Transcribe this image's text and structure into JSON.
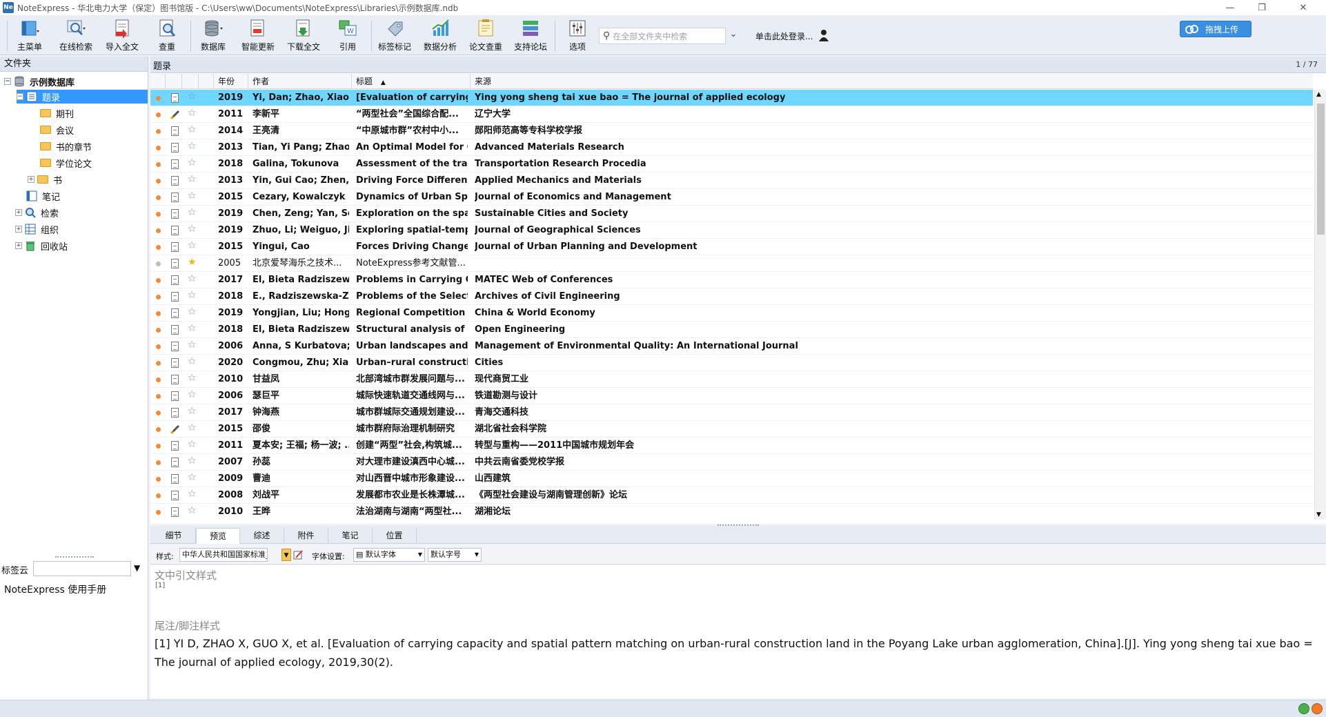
{
  "window": {
    "title": "NoteExpress - 华北电力大学（保定）图书馆版 - C:\\Users\\ww\\Documents\\NoteExpress\\Libraries\\示例数据库.ndb",
    "app_icon": "Ne"
  },
  "toolbar": {
    "buttons": [
      {
        "label": "主菜单",
        "icon": "main-menu-icon"
      },
      {
        "label": "在线检索",
        "icon": "online-search-icon"
      },
      {
        "label": "导入全文",
        "icon": "import-fulltext-icon"
      },
      {
        "label": "查重",
        "icon": "duplicate-check-icon"
      },
      {
        "label": "数据库",
        "icon": "database-icon"
      },
      {
        "label": "智能更新",
        "icon": "smart-update-icon"
      },
      {
        "label": "下载全文",
        "icon": "download-fulltext-icon"
      },
      {
        "label": "引用",
        "icon": "cite-icon"
      },
      {
        "label": "标签标记",
        "icon": "tag-icon"
      },
      {
        "label": "数据分析",
        "icon": "data-analysis-icon"
      },
      {
        "label": "论文查重",
        "icon": "paper-check-icon"
      },
      {
        "label": "支持论坛",
        "icon": "forum-icon"
      },
      {
        "label": "选项",
        "icon": "options-icon"
      }
    ],
    "search_placeholder": "在全部文件夹中检索",
    "login_label": "单击此处登录...",
    "upload_label": "拖拽上传"
  },
  "sidebar": {
    "header": "文件夹",
    "tree": [
      {
        "label": "示例数据库",
        "bold": true
      },
      {
        "label": "题录",
        "selected": true
      },
      {
        "label": "期刊"
      },
      {
        "label": "会议"
      },
      {
        "label": "书的章节"
      },
      {
        "label": "学位论文"
      },
      {
        "label": "书"
      },
      {
        "label": "笔记"
      },
      {
        "label": "检索"
      },
      {
        "label": "组织"
      },
      {
        "label": "回收站"
      }
    ],
    "tag_cloud_label": "标签云",
    "tag_items": [
      "NoteExpress  使用手册"
    ]
  },
  "list": {
    "header": "题录",
    "page_indicator": "1 / 77",
    "columns": [
      "年份",
      "作者",
      "标题",
      "来源"
    ],
    "sort_indicator": "▲",
    "rows": [
      {
        "year": "2019",
        "author": "Yi, Dan; Zhao, Xiao-...",
        "title": "[Evaluation of carrying c",
        "source": "Ying yong sheng tai xue bao = The journal of applied ecology",
        "selected": true
      },
      {
        "year": "2011",
        "author": "李新平",
        "title": "“两型社会”全国综合配...",
        "source": "辽宁大学",
        "pen": true
      },
      {
        "year": "2014",
        "author": "王亮清",
        "title": "“中原城市群”农村中小...",
        "source": "郧阳师范高等专科学校学报"
      },
      {
        "year": "2013",
        "author": "Tian, Yi Pang; Zhao,",
        "title": "An Optimal Model for C",
        "source": "Advanced Materials Research"
      },
      {
        "year": "2018",
        "author": "Galina, Tokunova",
        "title": "Assessment of the trans.",
        "source": "Transportation Research Procedia"
      },
      {
        "year": "2013",
        "author": "Yin, Gui Cao; Zhen, ..",
        "title": "Driving Force Difference",
        "source": "Applied Mechanics and Materials"
      },
      {
        "year": "2015",
        "author": "Cezary, Kowalczyk",
        "title": "Dynamics of Urban Spa.",
        "source": "Journal of Economics and Management"
      },
      {
        "year": "2019",
        "author": "Chen, Zeng; Yan, So.",
        "title": "Exploration on the spati",
        "source": "Sustainable Cities and Society"
      },
      {
        "year": "2019",
        "author": "Zhuo, Li; Weiguo, Jia",
        "title": "Exploring spatial-tempo",
        "source": "Journal of Geographical Sciences"
      },
      {
        "year": "2015",
        "author": "Yingui, Cao",
        "title": "Forces Driving Changes",
        "source": "Journal of Urban Planning and Development"
      },
      {
        "year": "2005",
        "author": "北京爱琴海乐之技术...",
        "title": "NoteExpress参考文献管...",
        "source": "",
        "plain": true,
        "grey": true,
        "gold": true
      },
      {
        "year": "2017",
        "author": "El, Bieta Radziszewsl",
        "title": "Problems in Carrying O.",
        "source": "MATEC Web of Conferences"
      },
      {
        "year": "2018",
        "author": "E., Radziszewska-Zie",
        "title": "Problems of the Selectic",
        "source": "Archives of Civil Engineering"
      },
      {
        "year": "2019",
        "author": "Yongjian, Liu; Hong,",
        "title": "Regional Competition ir",
        "source": "China & World Economy"
      },
      {
        "year": "2018",
        "author": "El, Bieta Radziszewsl",
        "title": "Structural analysis of co",
        "source": "Open Engineering"
      },
      {
        "year": "2006",
        "author": "Anna, S Kurbatova; ..",
        "title": "Urban landscapes and s.",
        "source": "Management of Environmental Quality: An International Journal"
      },
      {
        "year": "2020",
        "author": "Congmou, Zhu; Xiao",
        "title": "Urban–rural constructio",
        "source": "Cities"
      },
      {
        "year": "2010",
        "author": "甘益凤",
        "title": "北部湾城市群发展问题与...",
        "source": "现代商贸工业"
      },
      {
        "year": "2006",
        "author": "瑟巨平",
        "title": "城际快速轨道交通线网与...",
        "source": "铁道勘测与设计"
      },
      {
        "year": "2017",
        "author": "钟海燕",
        "title": "城市群城际交通规划建设...",
        "source": "青海交通科技"
      },
      {
        "year": "2015",
        "author": "邵俊",
        "title": "城市群府际治理机制研究",
        "source": "湖北省社会科学院",
        "pen": true
      },
      {
        "year": "2011",
        "author": "夏本安; 王福; 杨一波; ..",
        "title": "创建“两型”社会,构筑城...",
        "source": "转型与重构——2011中国城市规划年会"
      },
      {
        "year": "2007",
        "author": "孙蕊",
        "title": "对大理市建设滇西中心城...",
        "source": "中共云南省委党校学报"
      },
      {
        "year": "2009",
        "author": "曹迪",
        "title": "对山西晋中城市形象建设...",
        "source": "山西建筑"
      },
      {
        "year": "2008",
        "author": "刘战平",
        "title": "发展都市农业是长株潭城...",
        "source": "《两型社会建设与湖南管理创新》论坛"
      },
      {
        "year": "2010",
        "author": "王晔",
        "title": "法治湖南与湖南“两型社...",
        "source": "湖湘论坛"
      }
    ]
  },
  "preview": {
    "tabs": [
      "细节",
      "预览",
      "综述",
      "附件",
      "笔记",
      "位置"
    ],
    "active_tab": "预览",
    "style_label": "样式:",
    "style_value": "中华人民共和国国家标准_",
    "font_label": "字体设置:",
    "font_value": "默认字体",
    "size_value": "默认字号",
    "intext_heading": "文中引文样式",
    "intext_value": "[1]",
    "endnote_heading": "尾注/脚注样式",
    "reference": "[1]      YI D, ZHAO X, GUO X, et al. [Evaluation of carrying capacity and spatial pattern matching on urban-rural construction land in the Poyang Lake urban agglomeration, China].[J]. Ying yong sheng tai xue bao = The journal of applied ecology, 2019,30(2)."
  },
  "colors": {
    "selection_row": "#6fd6ff",
    "tree_selection": "#3399ff",
    "status_dot": "#f08a3c",
    "upload_button": "#3a8fe0"
  }
}
